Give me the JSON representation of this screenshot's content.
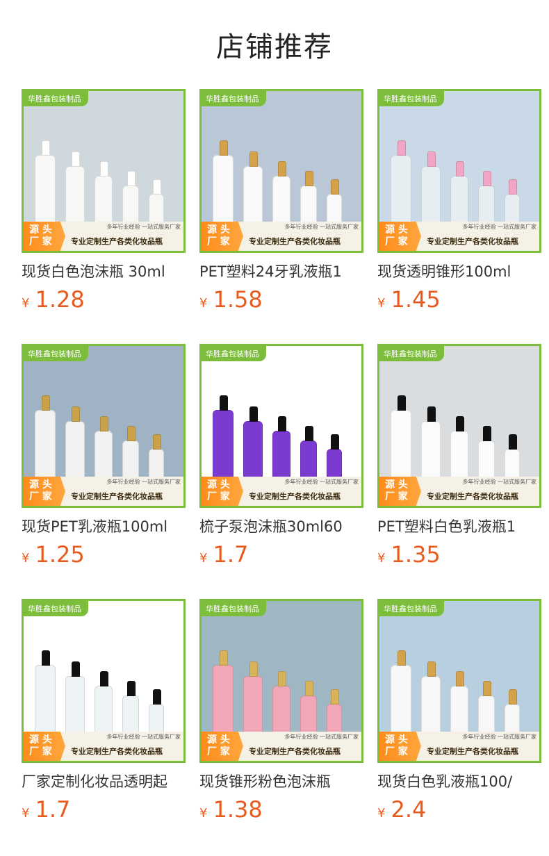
{
  "page_title": "店铺推荐",
  "brand_label": "华胜鑫包装制品",
  "banner": {
    "tag_line1": "源 头",
    "tag_line2": "厂 家",
    "top_text": "多年行业经验  一站式服务厂家",
    "slogan": "专业定制生产各类化妆品瓶"
  },
  "currency": "¥",
  "products": [
    {
      "title": "现货白色泡沫瓶 30ml",
      "price": "1.28",
      "scene_color": "#cfd8dc",
      "bottle_color": "#f7f7f5",
      "pump_color": "#ffffff"
    },
    {
      "title": "PET塑料24牙乳液瓶1",
      "price": "1.58",
      "scene_color": "#b9c7d6",
      "bottle_color": "#f9f9f9",
      "pump_color": "#d4a24a"
    },
    {
      "title": "现货透明锥形100ml",
      "price": "1.45",
      "scene_color": "#c9d9e8",
      "bottle_color": "#e7eef2",
      "pump_color": "#f0a6c4"
    },
    {
      "title": "现货PET乳液瓶100ml",
      "price": "1.25",
      "scene_color": "#9fb3c4",
      "bottle_color": "#f2f2f2",
      "pump_color": "#c9a14b"
    },
    {
      "title": "梳子泵泡沫瓶30ml60",
      "price": "1.7",
      "scene_color": "#ffffff",
      "bottle_color": "#7b3ad0",
      "pump_color": "#111111"
    },
    {
      "title": "PET塑料白色乳液瓶1",
      "price": "1.35",
      "scene_color": "#d9dde0",
      "bottle_color": "#fbfbfb",
      "pump_color": "#111111"
    },
    {
      "title": "厂家定制化妆品透明起",
      "price": "1.7",
      "scene_color": "#ffffff",
      "bottle_color": "#eef3f6",
      "pump_color": "#111111"
    },
    {
      "title": "现货锥形粉色泡沫瓶",
      "price": "1.38",
      "scene_color": "#9fb7c2",
      "bottle_color": "#f1a7b8",
      "pump_color": "#d8b35a"
    },
    {
      "title": "现货白色乳液瓶100/",
      "price": "2.4",
      "scene_color": "#b8cfe0",
      "bottle_color": "#f7f7f7",
      "pump_color": "#d4a24a"
    }
  ]
}
